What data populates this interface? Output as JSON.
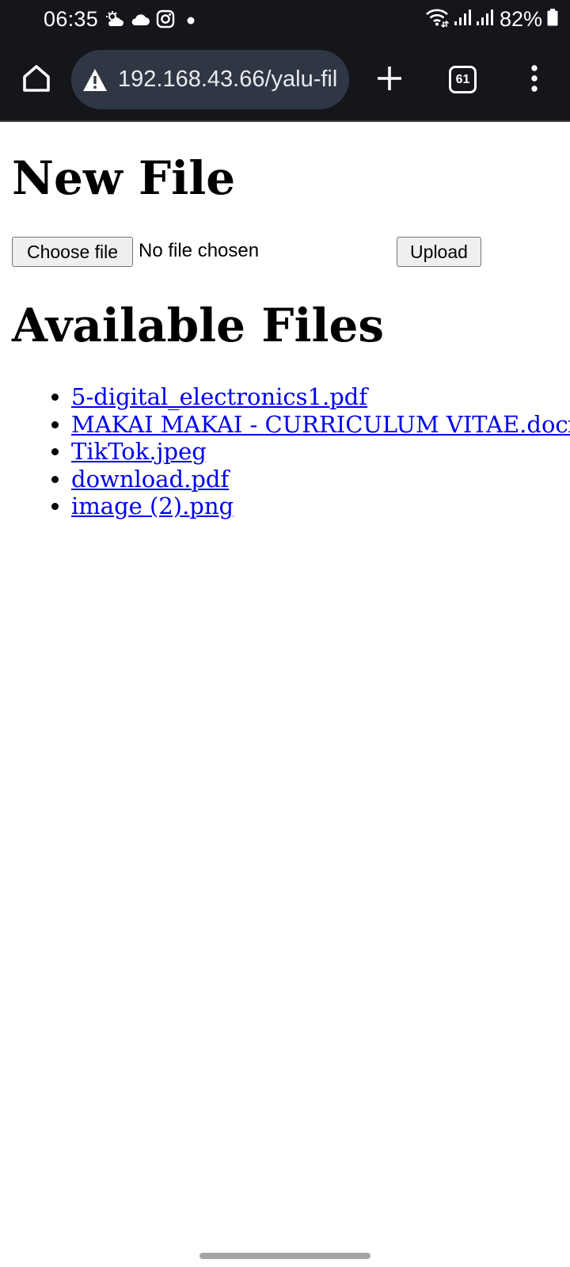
{
  "status_bar": {
    "time": "06:35",
    "battery_percent": "82%",
    "notification_icons": [
      "weather-icon",
      "cloud-icon",
      "instagram-icon",
      "dot-icon"
    ],
    "system_icons": [
      "wifi-icon",
      "signal-icon",
      "signal-icon",
      "battery-icon"
    ]
  },
  "browser": {
    "url": "192.168.43.66/yalu-fil",
    "tab_count": "61",
    "icons": [
      "home-icon",
      "warning-icon",
      "plus-icon",
      "tabs-icon",
      "more-vert-icon"
    ]
  },
  "page": {
    "new_file_title": "New File",
    "choose_file_label": "Choose file",
    "no_file_text": "No file chosen",
    "upload_label": "Upload",
    "available_title": "Available Files",
    "files": [
      "5-digital_electronics1.pdf",
      "MAKAI MAKAI - CURRICULUM VITAE.docx",
      "TikTok.jpeg",
      "download.pdf",
      "image (2).png"
    ]
  },
  "colors": {
    "chrome_background": "#14161b",
    "url_pill": "#303744",
    "link": "#0000ee",
    "button_background": "#efefef"
  }
}
